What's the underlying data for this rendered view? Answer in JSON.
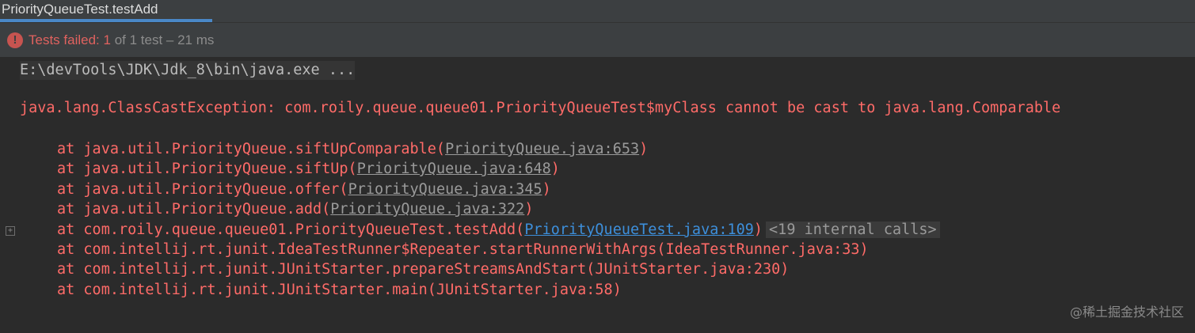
{
  "tab": {
    "title": "PriorityQueueTest.testAdd"
  },
  "status": {
    "icon": "error-icon",
    "prefix": "Tests failed: ",
    "failed_count": "1",
    "suffix": " of 1 test – 21 ms"
  },
  "console": {
    "command": "E:\\devTools\\JDK\\Jdk_8\\bin\\java.exe ...",
    "exception": "java.lang.ClassCastException: com.roily.queue.queue01.PriorityQueueTest$myClass cannot be cast to java.lang.Comparable",
    "stack": [
      {
        "method": "at java.util.PriorityQueue.siftUpComparable(",
        "link": "PriorityQueue.java:653",
        "end": ")"
      },
      {
        "method": "at java.util.PriorityQueue.siftUp(",
        "link": "PriorityQueue.java:648",
        "end": ")"
      },
      {
        "method": "at java.util.PriorityQueue.offer(",
        "link": "PriorityQueue.java:345",
        "end": ")"
      },
      {
        "method": "at java.util.PriorityQueue.add(",
        "link": "PriorityQueue.java:322",
        "end": ")"
      },
      {
        "method": "at com.roily.queue.queue01.PriorityQueueTest.testAdd(",
        "link": "PriorityQueueTest.java:109",
        "end": ")",
        "internal_calls": "<19 internal calls>"
      },
      {
        "method": "at com.intellij.rt.junit.IdeaTestRunner$Repeater.startRunnerWithArgs(IdeaTestRunner.java:33)"
      },
      {
        "method": "at com.intellij.rt.junit.JUnitStarter.prepareStreamsAndStart(JUnitStarter.java:230)"
      },
      {
        "method": "at com.intellij.rt.junit.JUnitStarter.main(JUnitStarter.java:58)"
      }
    ],
    "fold_icon": "expand-icon"
  },
  "watermark": "@稀土掘金技术社区",
  "colors": {
    "error": "#ff6b68",
    "link_blue": "#3d8fdb",
    "background": "#2b2b2b",
    "tab_underline": "#4a88c7"
  }
}
